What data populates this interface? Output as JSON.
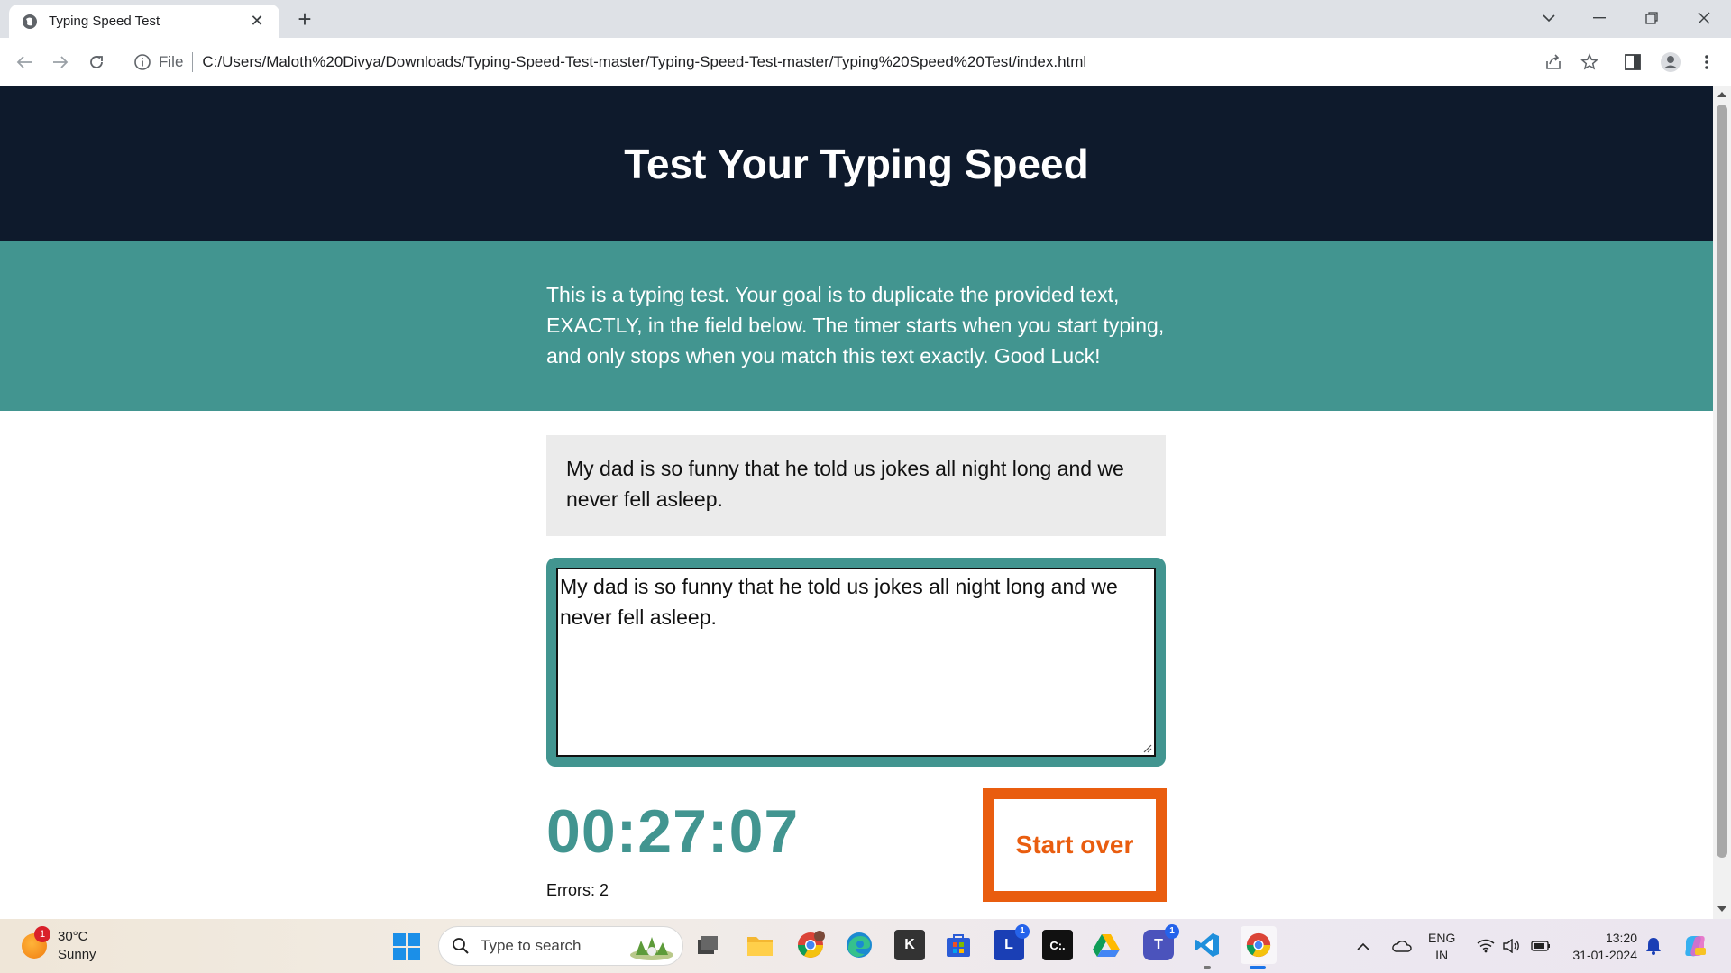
{
  "browser": {
    "tab_title": "Typing Speed Test",
    "address_scheme": "File",
    "address_url": "C:/Users/Maloth%20Divya/Downloads/Typing-Speed-Test-master/Typing-Speed-Test-master/Typing%20Speed%20Test/index.html"
  },
  "page": {
    "heading": "Test Your Typing Speed",
    "intro": "This is a typing test. Your goal is to duplicate the provided text, EXACTLY, in the field below. The timer starts when you start typing, and only stops when you match this text exactly. Good Luck!",
    "origin_text": "My dad is so funny that he told us jokes all night long and we never fell asleep.",
    "typed_text": "My dad is so funny that he told us jokes all night long and we never fell asleep.",
    "timer": "00:27:07",
    "errors": "Errors: 2",
    "reset_label": "Start over",
    "accent_color": "#429590",
    "header_color": "#0e1a2c",
    "button_color": "#e95d0f"
  },
  "taskbar": {
    "weather_temp": "30°C",
    "weather_desc": "Sunny",
    "weather_badge": "1",
    "search_placeholder": "Type to search",
    "apps": [
      {
        "icon": "file-explorer-icon"
      },
      {
        "icon": "chrome-profile-icon"
      },
      {
        "icon": "edge-icon"
      },
      {
        "icon": "k-app-icon",
        "label": "K"
      },
      {
        "icon": "microsoft-store-icon"
      },
      {
        "icon": "l-app-icon",
        "label": "L",
        "badge": "1"
      },
      {
        "icon": "c-app-icon",
        "label": "C:."
      },
      {
        "icon": "google-drive-icon"
      },
      {
        "icon": "teams-icon",
        "label": "T",
        "badge": "1"
      },
      {
        "icon": "vscode-icon"
      },
      {
        "icon": "chrome-icon"
      }
    ],
    "lang_line1": "ENG",
    "lang_line2": "IN",
    "time": "13:20",
    "date": "31-01-2024"
  }
}
